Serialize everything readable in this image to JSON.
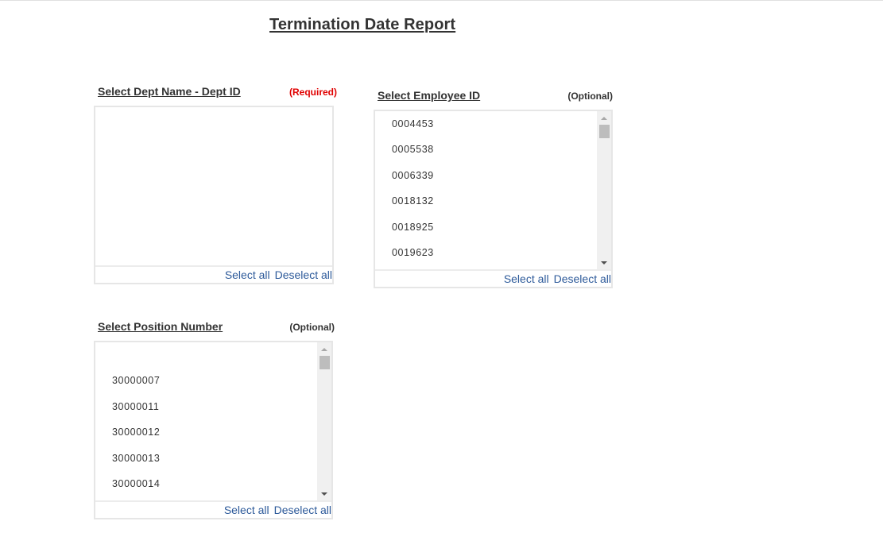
{
  "page": {
    "title": "Termination Date Report"
  },
  "dept_panel": {
    "label": "Select Dept Name - Dept ID",
    "tag": "(Required)",
    "items": [],
    "select_all": "Select all",
    "deselect_all": "Deselect all"
  },
  "employee_panel": {
    "label": "Select Employee ID",
    "tag": "(Optional)",
    "items": [
      "0004453",
      "0005538",
      "0006339",
      "0018132",
      "0018925",
      "0019623"
    ],
    "select_all": "Select all",
    "deselect_all": "Deselect all"
  },
  "position_panel": {
    "label": "Select Position Number",
    "tag": "(Optional)",
    "items": [
      "",
      "30000007",
      "30000011",
      "30000012",
      "30000013",
      "30000014"
    ],
    "select_all": "Select all",
    "deselect_all": "Deselect all"
  },
  "colors": {
    "required": "#e00000",
    "link": "#2d5a9a",
    "text": "#333333"
  }
}
